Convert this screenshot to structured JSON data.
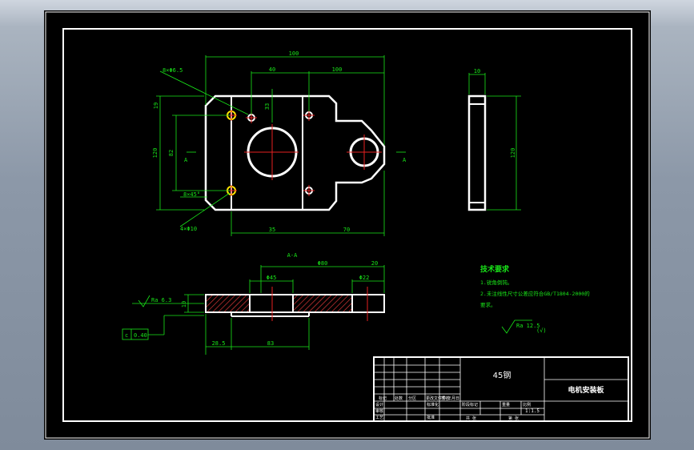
{
  "top_view": {
    "dim_total_width": "100",
    "dim_hole_x1": "40",
    "dim_hole_x2": "100",
    "dim_hole_dia": "8×Φ6.5",
    "dim_top_offset": "19",
    "dim_hole_y": "33",
    "dim_height": "120",
    "dim_inner_height": "82",
    "dim_chamfer": "8×45°",
    "dim_counterbore": "4×Φ10",
    "dim_left_part": "35",
    "dim_right_part": "70",
    "section_mark": "A"
  },
  "side_view": {
    "dim_thickness": "10",
    "dim_height": "120"
  },
  "section_view": {
    "title": "A-A",
    "dim_span": "Φ80",
    "dim_bore_left": "Φ45",
    "dim_bore_right": "Φ22",
    "dim_edge": "20",
    "dim_thk": "10",
    "roughness_left": "Ra 6.3",
    "dim_bottom_left": "28.5",
    "dim_bottom_mid": "83",
    "geom_symbol": "c",
    "geom_value": "0.40"
  },
  "tech_requirements": {
    "title": "技术要求",
    "line1": "1.锐角倒钝。",
    "line2": "2.未注线性尺寸公差应符合GB/T1804-2000的",
    "line3": "要求。",
    "roughness": "Ra 12.5",
    "roughness_suffix": "(√)"
  },
  "title_block": {
    "material": "45钢",
    "part_name": "电机安装板",
    "scale": "1:1.5",
    "labels": [
      "标记",
      "处数",
      "分区",
      "更改文件号",
      "签名",
      "年月日",
      "设计",
      "标准化",
      "审核",
      "工艺",
      "批准",
      "阶段标记",
      "重量",
      "比例",
      "共 张",
      "第 张"
    ]
  },
  "colors": {
    "background": "#000000",
    "outline": "#ffffff",
    "dimension": "#19e619",
    "centerline": "#e62020",
    "highlight": "#ffe600",
    "hatch": "#ff4040",
    "border": "#ffffff"
  }
}
